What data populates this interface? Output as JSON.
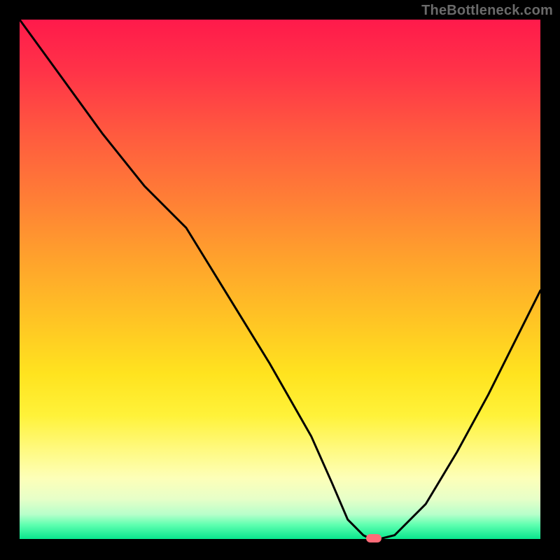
{
  "watermark": "TheBottleneck.com",
  "colors": {
    "background": "#000000",
    "curve": "#000000",
    "marker": "#ff6b78",
    "watermark_text": "#6a6a6a",
    "gradient_top": "#ff1a4b",
    "gradient_bottom": "#00e58a"
  },
  "chart_data": {
    "type": "line",
    "title": "",
    "xlabel": "",
    "ylabel": "",
    "xlim": [
      0,
      100
    ],
    "ylim": [
      0,
      100
    ],
    "grid": false,
    "legend": false,
    "series": [
      {
        "name": "bottleneck-curve",
        "x": [
          0,
          8,
          16,
          24,
          32,
          40,
          48,
          56,
          60,
          63,
          66,
          68,
          72,
          78,
          84,
          90,
          96,
          100
        ],
        "y": [
          100,
          89,
          78,
          68,
          60,
          47,
          34,
          20,
          11,
          4,
          1,
          0,
          1,
          7,
          17,
          28,
          40,
          48
        ]
      }
    ],
    "min_point": {
      "x": 68,
      "y": 0
    },
    "annotations": []
  }
}
